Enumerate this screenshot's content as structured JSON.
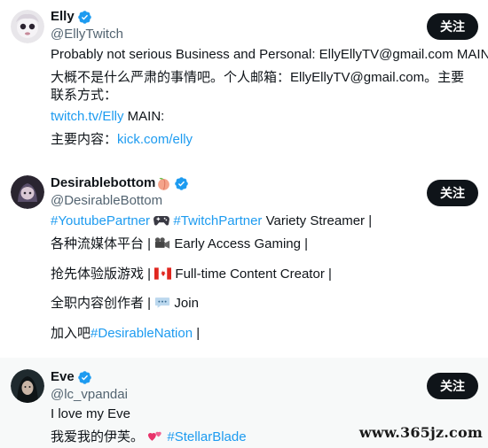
{
  "users": [
    {
      "display_name": "Elly",
      "handle": "@EllyTwitch",
      "follow_label": "关注",
      "bio": {
        "line1": "Probably not serious Business and Personal: EllyEllyTV@gmail.com MAIN:",
        "line2": "大概不是什么严肃的事情吧。个人邮箱：EllyEllyTV@gmail.com。主要联系方式：",
        "line3_link": "twitch.tv/Elly",
        "line3_text": " MAIN:",
        "line4_text": "主要内容：",
        "line4_link": "kick.com/elly"
      }
    },
    {
      "display_name": "Desirablebottom",
      "handle": "@DesirableBottom",
      "follow_label": "关注",
      "bio": {
        "line1_tag1": "#YoutubePartner",
        "line1_tag2": "#TwitchPartner",
        "line1_text": " Variety Streamer |",
        "line2_a": "各种流媒体平台 |",
        "line2_b": " Early Access Gaming |",
        "line3_a": "抢先体验版游戏 |",
        "line3_b": " Full-time Content Creator |",
        "line4_a": "全职内容创作者 |",
        "line4_b": " Join",
        "line5_text": "加入吧",
        "line5_link": "#DesirableNation",
        "line5_end": " |"
      }
    },
    {
      "display_name": "Eve",
      "handle": "@lc_vpandai",
      "follow_label": "关注",
      "bio": {
        "line1": "I love my Eve",
        "line2_text": "我爱我的伊芙。",
        "line2_link": "#StellarBlade"
      }
    }
  ],
  "watermark": "www.365jz.com",
  "colors": {
    "accent": "#1d9bf0",
    "text": "#0f1419",
    "secondary": "#536471",
    "button": "#0f1419",
    "highlight_bg": "#f7f9f9"
  },
  "icons": [
    "verified-badge-icon",
    "peach-emoji-icon",
    "game-controller-emoji-icon",
    "movie-camera-emoji-icon",
    "canada-flag-emoji-icon",
    "speech-balloon-emoji-icon",
    "two-hearts-emoji-icon"
  ]
}
